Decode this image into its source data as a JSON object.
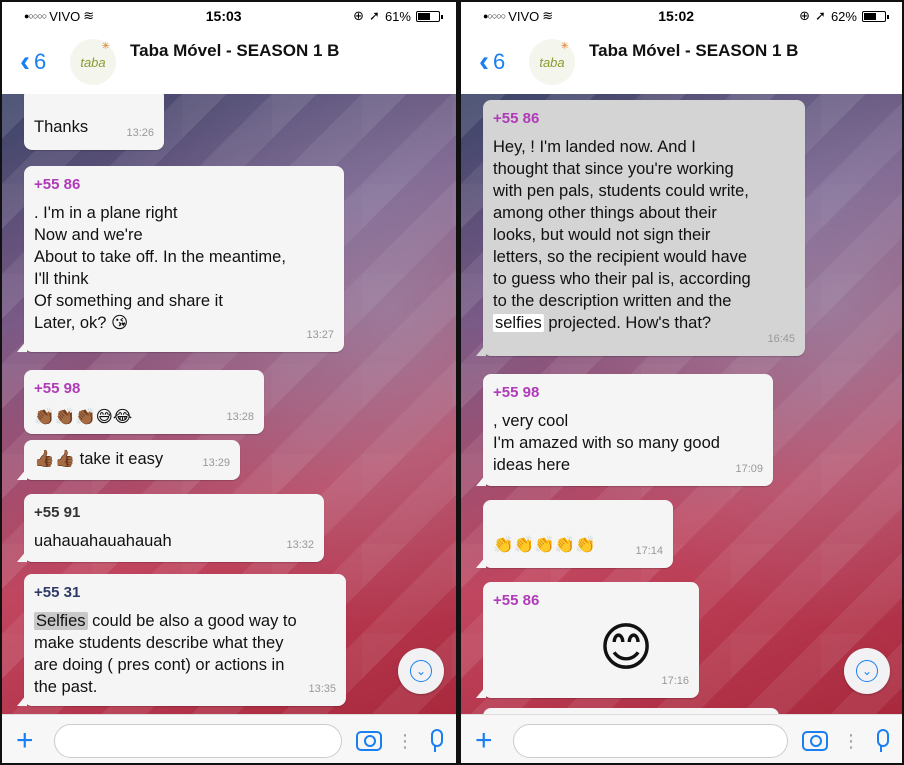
{
  "left": {
    "status": {
      "carrier": "VIVO",
      "time": "15:03",
      "battery": "61%",
      "battery_level": 0.61
    },
    "header": {
      "back_count": "6",
      "title": "Taba Móvel - SEASON 1 B",
      "avatar_text": "taba"
    },
    "messages": [
      {
        "text": "Thanks",
        "time": "13:26"
      },
      {
        "sender": "+55 86",
        "sender_color": "#b03ab8",
        "text": "      . I'm in a plane right\nNow and we're\nAbout to take off. In the meantime,\nI'll think\nOf something and share it\nLater, ok? 😘",
        "time": "13:27"
      },
      {
        "sender": "+55 98",
        "sender_color": "#b03ab8",
        "text": "👏🏾👏🏾👏🏾😅😂",
        "time": "13:28"
      },
      {
        "text": "👍🏾👍🏾 take it easy",
        "time": "13:29"
      },
      {
        "sender": "+55 91",
        "sender_color": "#333333",
        "text": "uahauahauahauah",
        "time": "13:32"
      },
      {
        "sender": "+55 31",
        "sender_color": "#2f3b66",
        "highlight": "Selfies",
        "text": " could be also a good way to\nmake students describe what they\nare doing ( pres cont) or actions in\nthe past.",
        "time": "13:35"
      }
    ]
  },
  "right": {
    "status": {
      "carrier": "VIVO",
      "time": "15:02",
      "battery": "62%",
      "battery_level": 0.62
    },
    "header": {
      "back_count": "6",
      "title": "Taba Móvel - SEASON 1 B",
      "avatar_text": "taba"
    },
    "messages": [
      {
        "sender": "+55 86",
        "sender_color": "#b03ab8",
        "text": "Hey,       ! I'm landed now. And I\nthought that since you're  working\nwith pen pals, students could write,\namong other things about their\nlooks, but would not sign their\nletters, so the recipient would have\nto guess who their pal is, according\nto the description written and the\n",
        "highlight": "selfies",
        "text_after": " projected. How's that?",
        "time": "16:45"
      },
      {
        "sender": "+55 98",
        "sender_color": "#b03ab8",
        "text": "       , very cool\nI'm amazed with so many good\nideas here",
        "time": "17:09"
      },
      {
        "text": "👏👏👏👏👏",
        "time": "17:14"
      },
      {
        "sender": "+55 86",
        "sender_color": "#b03ab8",
        "text": "😊",
        "time": "17:16"
      }
    ]
  }
}
